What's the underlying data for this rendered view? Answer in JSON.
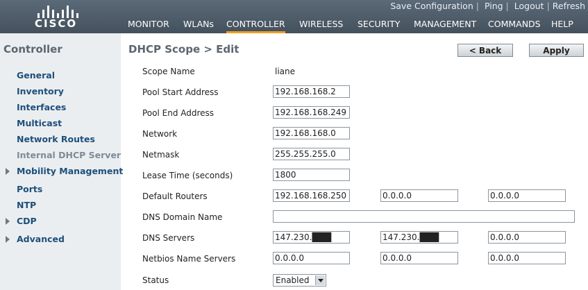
{
  "brand": {
    "name": "CISCO"
  },
  "top_links": {
    "save": "Save Configuration",
    "ping": "Ping",
    "logout": "Logout",
    "refresh": "Refresh"
  },
  "nav": [
    "MONITOR",
    "WLANs",
    "CONTROLLER",
    "WIRELESS",
    "SECURITY",
    "MANAGEMENT",
    "COMMANDS",
    "HELP"
  ],
  "nav_active": "CONTROLLER",
  "colors": {
    "header": "#4e5b68",
    "sidebar": "#ebeef1",
    "active_tab_underline": "#f0a024",
    "link": "#1d4f7a"
  },
  "sidebar": {
    "title": "Controller",
    "items": [
      "General",
      "Inventory",
      "Interfaces",
      "Multicast",
      "Network Routes",
      "Internal DHCP Server",
      "Mobility Management",
      "Ports",
      "NTP",
      "CDP",
      "Advanced"
    ]
  },
  "page": {
    "title": "DHCP Scope > Edit",
    "back": "< Back",
    "apply": "Apply"
  },
  "form": {
    "scope_name": {
      "label": "Scope Name",
      "value": "liane"
    },
    "pool_start": {
      "label": "Pool Start Address",
      "value": "192.168.168.2"
    },
    "pool_end": {
      "label": "Pool End Address",
      "value": "192.168.168.249"
    },
    "network": {
      "label": "Network",
      "value": "192.168.168.0"
    },
    "netmask": {
      "label": "Netmask",
      "value": "255.255.255.0"
    },
    "lease": {
      "label": "Lease Time (seconds)",
      "value": "1800"
    },
    "routers": {
      "label": "Default Routers",
      "values": [
        "192.168.168.250",
        "0.0.0.0",
        "0.0.0.0"
      ]
    },
    "dns_domain": {
      "label": "DNS Domain Name",
      "value": ""
    },
    "dns_servers": {
      "label": "DNS Servers",
      "values": [
        "147.230.███",
        "147.230.███",
        "0.0.0.0"
      ]
    },
    "netbios": {
      "label": "Netbios Name Servers",
      "values": [
        "0.0.0.0",
        "0.0.0.0",
        "0.0.0.0"
      ]
    },
    "status": {
      "label": "Status",
      "value": "Enabled"
    }
  }
}
